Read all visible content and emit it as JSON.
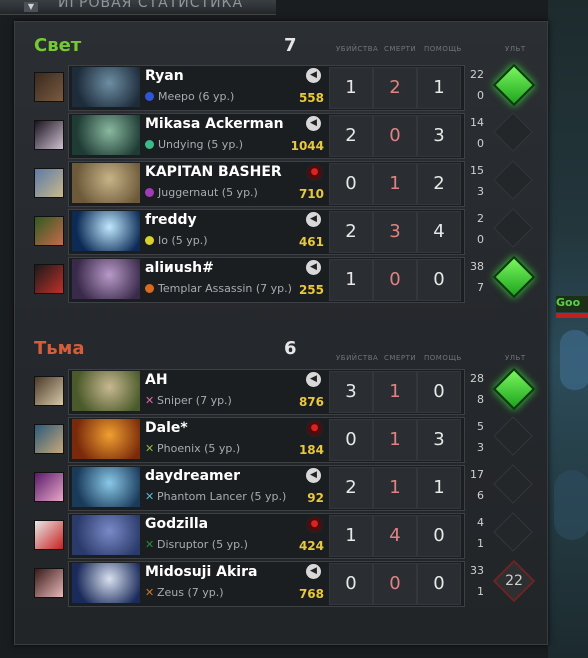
{
  "header": {
    "arrow": "▼",
    "title": "ИГРОВАЯ СТАТИСТИКА"
  },
  "hud": {
    "tag": "Goo"
  },
  "columns": {
    "kills": "УБИЙСТВА",
    "deaths": "СМЕРТИ",
    "assists": "ПОМОЩЬ",
    "ult": "УЛЬТ"
  },
  "colors": {
    "radiant": "#77c934",
    "dire": "#d65c3a",
    "networth": "#e9c93b",
    "deaths": "#e28282"
  },
  "teams": [
    {
      "name": "Свет",
      "score": "7",
      "players": [
        {
          "name": "Ryan",
          "hero": "Meepo (6 ур.)",
          "hero_color": "#2e56d6",
          "marker": "dot",
          "networth": "558",
          "kills": "1",
          "deaths": "2",
          "assists": "1",
          "ult_top": "22",
          "ult_bottom": "0",
          "ult_state": "ready",
          "voice": "speaker",
          "avatar": [
            "#3a2a20",
            "#7a5a40"
          ],
          "portrait": [
            "#1d2b3a",
            "#6d8ea3"
          ]
        },
        {
          "name": "Mikasa Ackerman",
          "hero": "Undying (5 ур.)",
          "hero_color": "#3bbb8a",
          "marker": "dot",
          "networth": "1044",
          "kills": "2",
          "deaths": "0",
          "assists": "3",
          "ult_top": "14",
          "ult_bottom": "0",
          "ult_state": "empty",
          "voice": "speaker",
          "avatar": [
            "#1a1420",
            "#cfc0d0"
          ],
          "portrait": [
            "#1e3b34",
            "#8ab8a0"
          ]
        },
        {
          "name": "KAPITAN BASHER",
          "hero": "Juggernaut (5 ур.)",
          "hero_color": "#a33ab8",
          "marker": "dot",
          "networth": "710",
          "kills": "0",
          "deaths": "1",
          "assists": "2",
          "ult_top": "15",
          "ult_bottom": "3",
          "ult_state": "empty",
          "voice": "muted",
          "avatar": [
            "#5c7aa8",
            "#c9b98a"
          ],
          "portrait": [
            "#6d5a3a",
            "#c8b488"
          ]
        },
        {
          "name": "freddy",
          "hero": "Io (5 ур.)",
          "hero_color": "#d8d22b",
          "marker": "dot",
          "networth": "461",
          "kills": "2",
          "deaths": "3",
          "assists": "4",
          "ult_top": "2",
          "ult_bottom": "0",
          "ult_state": "empty",
          "voice": "speaker",
          "avatar": [
            "#2f5a22",
            "#c86a4a"
          ],
          "portrait": [
            "#0c2a55",
            "#bfe8ff"
          ]
        },
        {
          "name": "aliиush#",
          "hero": "Templar Assassin (7 ур.)",
          "hero_color": "#d86a1e",
          "marker": "dot",
          "networth": "255",
          "kills": "1",
          "deaths": "0",
          "assists": "0",
          "ult_top": "38",
          "ult_bottom": "7",
          "ult_state": "ready",
          "voice": "speaker",
          "avatar": [
            "#1a1a1a",
            "#c0302a"
          ],
          "portrait": [
            "#3a2a4a",
            "#b89ac8"
          ]
        }
      ]
    },
    {
      "name": "Тьма",
      "score": "6",
      "players": [
        {
          "name": "AH",
          "hero": "Sniper (7 ур.)",
          "hero_color": "#d86aa8",
          "marker": "cross",
          "networth": "876",
          "kills": "3",
          "deaths": "1",
          "assists": "0",
          "ult_top": "28",
          "ult_bottom": "8",
          "ult_state": "ready",
          "voice": "speaker",
          "avatar": [
            "#4a3a2a",
            "#d8c8a8"
          ],
          "portrait": [
            "#4a5a2a",
            "#c8b890"
          ]
        },
        {
          "name": "Dale*",
          "hero": "Phoenix (5 ур.)",
          "hero_color": "#8ab848",
          "marker": "cross",
          "networth": "184",
          "kills": "0",
          "deaths": "1",
          "assists": "3",
          "ult_top": "5",
          "ult_bottom": "3",
          "ult_state": "empty",
          "voice": "muted",
          "avatar": [
            "#2a5a7a",
            "#c8a878"
          ],
          "portrait": [
            "#7a2a0a",
            "#f0a030"
          ]
        },
        {
          "name": "daydreamer",
          "hero": "Phantom Lancer (5 ур.)",
          "hero_color": "#5ab8d8",
          "marker": "cross",
          "networth": "92",
          "kills": "2",
          "deaths": "1",
          "assists": "1",
          "ult_top": "17",
          "ult_bottom": "6",
          "ult_state": "empty",
          "voice": "speaker",
          "avatar": [
            "#5a1a6a",
            "#e8a8c8"
          ],
          "portrait": [
            "#1a3a5a",
            "#8ac8e8"
          ]
        },
        {
          "name": "Godzilla",
          "hero": "Disruptor (5 ур.)",
          "hero_color": "#2a8a3a",
          "marker": "cross",
          "networth": "424",
          "kills": "1",
          "deaths": "4",
          "assists": "0",
          "ult_top": "4",
          "ult_bottom": "1",
          "ult_state": "empty",
          "voice": "muted",
          "avatar": [
            "#e8e8e8",
            "#c82020"
          ],
          "portrait": [
            "#2a3a6a",
            "#7a8ac8"
          ]
        },
        {
          "name": "Midosuji Akira",
          "hero": "Zeus (7 ур.)",
          "hero_color": "#c87a2a",
          "marker": "cross",
          "networth": "768",
          "kills": "0",
          "deaths": "0",
          "assists": "0",
          "ult_top": "33",
          "ult_bottom": "1",
          "ult_state": "cooldown",
          "ult_cd": "22",
          "voice": "speaker",
          "avatar": [
            "#3a1a1a",
            "#e8b8b8"
          ],
          "portrait": [
            "#1a2a5a",
            "#d8e0f0"
          ]
        }
      ]
    }
  ]
}
